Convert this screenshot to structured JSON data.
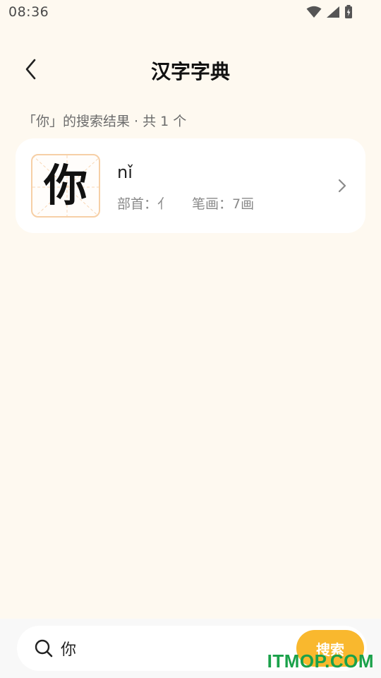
{
  "status_bar": {
    "time": "08:36",
    "icons": [
      "wifi-icon",
      "signal-icon",
      "battery-charging-icon"
    ]
  },
  "header": {
    "title": "汉字字典",
    "back_icon": "chevron-left-icon"
  },
  "results": {
    "summary": "「你」的搜索结果 · 共 1 个",
    "items": [
      {
        "character": "你",
        "pinyin": "nǐ",
        "radical": "部首：亻",
        "strokes": "笔画：7画"
      }
    ]
  },
  "search": {
    "value": "你",
    "button_label": "搜索"
  },
  "watermark": "ITMOP.COM",
  "colors": {
    "background": "#fef9f0",
    "accent": "#f9b82e",
    "char_box_border": "#f6cfa6",
    "watermark": "#1aa14a"
  }
}
